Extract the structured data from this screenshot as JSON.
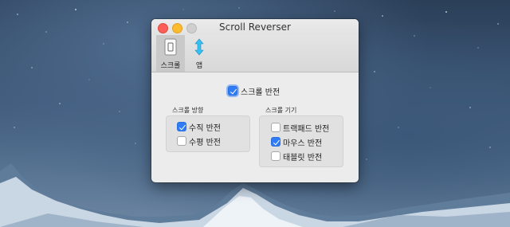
{
  "window": {
    "title": "Scroll Reverser"
  },
  "toolbar": {
    "items": [
      {
        "label": "스크롤",
        "selected": true,
        "icon": "scroll-icon"
      },
      {
        "label": "앱",
        "selected": false,
        "icon": "updown-arrow-icon"
      }
    ]
  },
  "main": {
    "reverse_scroll": {
      "label": "스크롤 반전",
      "checked": true
    }
  },
  "scroll_direction": {
    "title": "스크롤 방향",
    "options": [
      {
        "label": "수직 반전",
        "checked": true
      },
      {
        "label": "수평 반전",
        "checked": false
      }
    ]
  },
  "scroll_devices": {
    "title": "스크롤 기기",
    "options": [
      {
        "label": "트랙패드 반전",
        "checked": false
      },
      {
        "label": "마우스 반전",
        "checked": true
      },
      {
        "label": "태블릿 반전",
        "checked": false
      }
    ]
  },
  "colors": {
    "accent": "#2f7cf6",
    "close": "#fc5f57",
    "minimize": "#fdbc2e",
    "window_bg": "#ececec"
  }
}
